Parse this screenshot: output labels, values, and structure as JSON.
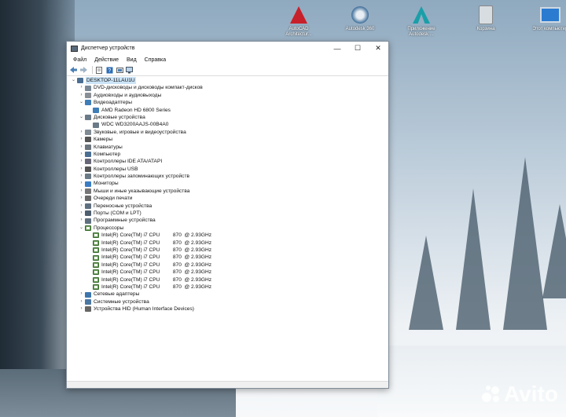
{
  "desktop": {
    "icons": [
      {
        "label": "AutoCAD Architectur...",
        "icon": "autocad-icon",
        "color": "#c8202a"
      },
      {
        "label": "Autodesk 360",
        "icon": "autodesk360-icon",
        "color": "#3d6d99"
      },
      {
        "label": "Приложение Autodesk ...",
        "icon": "autodesk-app-icon",
        "color": "#1a9fa8"
      },
      {
        "label": "Корзина",
        "icon": "recycle-bin-icon",
        "color": "#d8dde2"
      },
      {
        "label": "Этот компьютер",
        "icon": "this-pc-icon",
        "color": "#2b7bd1"
      }
    ],
    "watermark": "Avito"
  },
  "window": {
    "title": "Диспетчер устройств",
    "controls": {
      "minimize": "—",
      "maximize": "☐",
      "close": "✕"
    },
    "menu": [
      "Файл",
      "Действие",
      "Вид",
      "Справка"
    ],
    "tree": [
      {
        "level": 0,
        "expand": "v",
        "label": "DESKTOP-11LAU1U",
        "icon": "computer-icon",
        "selected": true
      },
      {
        "level": 1,
        "expand": ">",
        "label": "DVD-дисководы и дисководы компакт-дисков",
        "icon": "dvd-icon"
      },
      {
        "level": 1,
        "expand": ">",
        "label": "Аудиовходы и аудиовыходы",
        "icon": "audio-icon"
      },
      {
        "level": 1,
        "expand": "v",
        "label": "Видеоадаптеры",
        "icon": "display-adapter-icon"
      },
      {
        "level": 2,
        "expand": "",
        "label": "AMD Radeon HD 6800 Series",
        "icon": "display-adapter-icon"
      },
      {
        "level": 1,
        "expand": "v",
        "label": "Дисковые устройства",
        "icon": "disk-icon"
      },
      {
        "level": 2,
        "expand": "",
        "label": "WDC WD3200AAJS-00B4A0",
        "icon": "disk-icon"
      },
      {
        "level": 1,
        "expand": ">",
        "label": "Звуковые, игровые и видеоустройства",
        "icon": "sound-icon"
      },
      {
        "level": 1,
        "expand": ">",
        "label": "Камеры",
        "icon": "camera-icon"
      },
      {
        "level": 1,
        "expand": ">",
        "label": "Клавиатуры",
        "icon": "keyboard-icon"
      },
      {
        "level": 1,
        "expand": ">",
        "label": "Компьютер",
        "icon": "computer-icon"
      },
      {
        "level": 1,
        "expand": ">",
        "label": "Контроллеры IDE ATA/ATAPI",
        "icon": "ide-icon"
      },
      {
        "level": 1,
        "expand": ">",
        "label": "Контроллеры USB",
        "icon": "usb-icon"
      },
      {
        "level": 1,
        "expand": ">",
        "label": "Контроллеры запоминающих устройств",
        "icon": "storage-icon"
      },
      {
        "level": 1,
        "expand": ">",
        "label": "Мониторы",
        "icon": "monitor-icon"
      },
      {
        "level": 1,
        "expand": ">",
        "label": "Мыши и иные указывающие устройства",
        "icon": "mouse-icon"
      },
      {
        "level": 1,
        "expand": ">",
        "label": "Очереди печати",
        "icon": "printer-icon"
      },
      {
        "level": 1,
        "expand": ">",
        "label": "Переносные устройства",
        "icon": "portable-icon"
      },
      {
        "level": 1,
        "expand": ">",
        "label": "Порты (COM и LPT)",
        "icon": "port-icon"
      },
      {
        "level": 1,
        "expand": ">",
        "label": "Программные устройства",
        "icon": "software-device-icon"
      },
      {
        "level": 1,
        "expand": "v",
        "label": "Процессоры",
        "icon": "processor-icon"
      },
      {
        "level": 2,
        "expand": "",
        "label": "Intel(R) Core(TM) i7 CPU         870  @ 2.93GHz",
        "icon": "processor-icon"
      },
      {
        "level": 2,
        "expand": "",
        "label": "Intel(R) Core(TM) i7 CPU         870  @ 2.93GHz",
        "icon": "processor-icon"
      },
      {
        "level": 2,
        "expand": "",
        "label": "Intel(R) Core(TM) i7 CPU         870  @ 2.93GHz",
        "icon": "processor-icon"
      },
      {
        "level": 2,
        "expand": "",
        "label": "Intel(R) Core(TM) i7 CPU         870  @ 2.93GHz",
        "icon": "processor-icon"
      },
      {
        "level": 2,
        "expand": "",
        "label": "Intel(R) Core(TM) i7 CPU         870  @ 2.93GHz",
        "icon": "processor-icon"
      },
      {
        "level": 2,
        "expand": "",
        "label": "Intel(R) Core(TM) i7 CPU         870  @ 2.93GHz",
        "icon": "processor-icon"
      },
      {
        "level": 2,
        "expand": "",
        "label": "Intel(R) Core(TM) i7 CPU         870  @ 2.93GHz",
        "icon": "processor-icon"
      },
      {
        "level": 2,
        "expand": "",
        "label": "Intel(R) Core(TM) i7 CPU         870  @ 2.93GHz",
        "icon": "processor-icon"
      },
      {
        "level": 1,
        "expand": ">",
        "label": "Сетевые адаптеры",
        "icon": "network-icon"
      },
      {
        "level": 1,
        "expand": ">",
        "label": "Системные устройства",
        "icon": "system-device-icon"
      },
      {
        "level": 1,
        "expand": ">",
        "label": "Устройства HID (Human Interface Devices)",
        "icon": "hid-icon"
      }
    ]
  },
  "colors": {
    "selection": "#cce4f7",
    "processor": "#3a6b2f",
    "device": "#5a7894"
  }
}
